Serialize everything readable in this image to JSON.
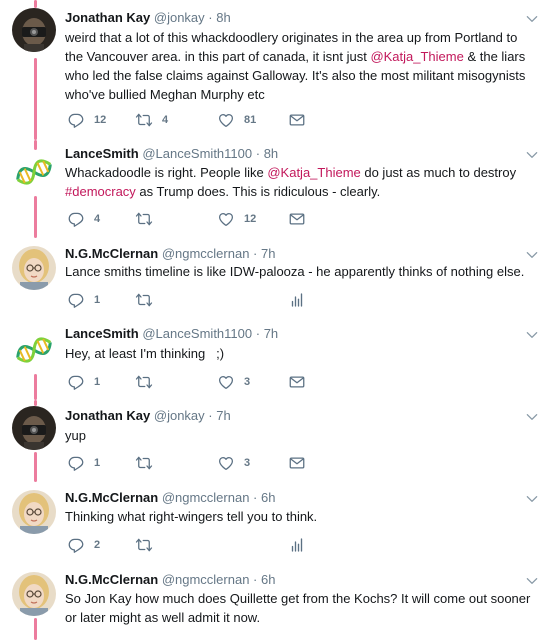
{
  "colors": {
    "accent": "#e0245e",
    "mention": "#c2185b",
    "muted": "#657786",
    "icon": "#5b7083"
  },
  "tweets": [
    {
      "name": "Jonathan Kay",
      "handle": "@jonkay",
      "time": "8h",
      "avatar": "jonathan-avatar",
      "body_parts": [
        {
          "text": "weird that a lot of this whackdoodlery originates in the area up from Portland to the Vancouver area. in this part of canada, it isnt just "
        },
        {
          "text": "@Katja_Thieme",
          "mention": true
        },
        {
          "text": " & the liars who led the false claims against Galloway. It's also the most militant misogynists who've bullied Meghan Murphy etc"
        }
      ],
      "reply_count": "12",
      "retweet_count": "4",
      "like_count": "81",
      "last_icon": "mail-icon"
    },
    {
      "name": "LanceSmith",
      "handle": "@LanceSmith1100",
      "time": "8h",
      "avatar": "dna-avatar",
      "body_parts": [
        {
          "text": "Whackadoodle is right. People like "
        },
        {
          "text": "@Katja_Thieme",
          "mention": true
        },
        {
          "text": " do just as much to destroy "
        },
        {
          "text": "#democracy",
          "mention": true
        },
        {
          "text": " as Trump does. This is ridiculous - clearly."
        }
      ],
      "reply_count": "4",
      "retweet_count": "",
      "like_count": "12",
      "last_icon": "mail-icon"
    },
    {
      "name": "N.G.McClernan",
      "handle": "@ngmcclernan",
      "time": "7h",
      "avatar": "ng-avatar",
      "body_parts": [
        {
          "text": "Lance smiths timeline is like IDW-palooza - he apparently thinks of nothing else."
        }
      ],
      "reply_count": "1",
      "retweet_count": "",
      "like_count": "",
      "last_icon": "analytics-icon"
    },
    {
      "name": "LanceSmith",
      "handle": "@LanceSmith1100",
      "time": "7h",
      "avatar": "dna-avatar",
      "body_parts": [
        {
          "text": "Hey, at least I'm thinking   ;)"
        }
      ],
      "reply_count": "1",
      "retweet_count": "",
      "like_count": "3",
      "last_icon": "mail-icon"
    },
    {
      "name": "Jonathan Kay",
      "handle": "@jonkay",
      "time": "7h",
      "avatar": "jonathan-avatar",
      "body_parts": [
        {
          "text": "yup"
        }
      ],
      "reply_count": "1",
      "retweet_count": "",
      "like_count": "3",
      "last_icon": "mail-icon"
    },
    {
      "name": "N.G.McClernan",
      "handle": "@ngmcclernan",
      "time": "6h",
      "avatar": "ng-avatar",
      "body_parts": [
        {
          "text": "Thinking what right-wingers tell you to think."
        }
      ],
      "reply_count": "2",
      "retweet_count": "",
      "like_count": "",
      "last_icon": "analytics-icon"
    },
    {
      "name": "N.G.McClernan",
      "handle": "@ngmcclernan",
      "time": "6h",
      "avatar": "ng-avatar",
      "body_parts": [
        {
          "text": "So Jon Kay how much does Quillette get from the Kochs? It will come out sooner or later might as well admit it now."
        }
      ],
      "reply_count": "",
      "retweet_count": "",
      "like_count": "",
      "last_icon": ""
    }
  ]
}
